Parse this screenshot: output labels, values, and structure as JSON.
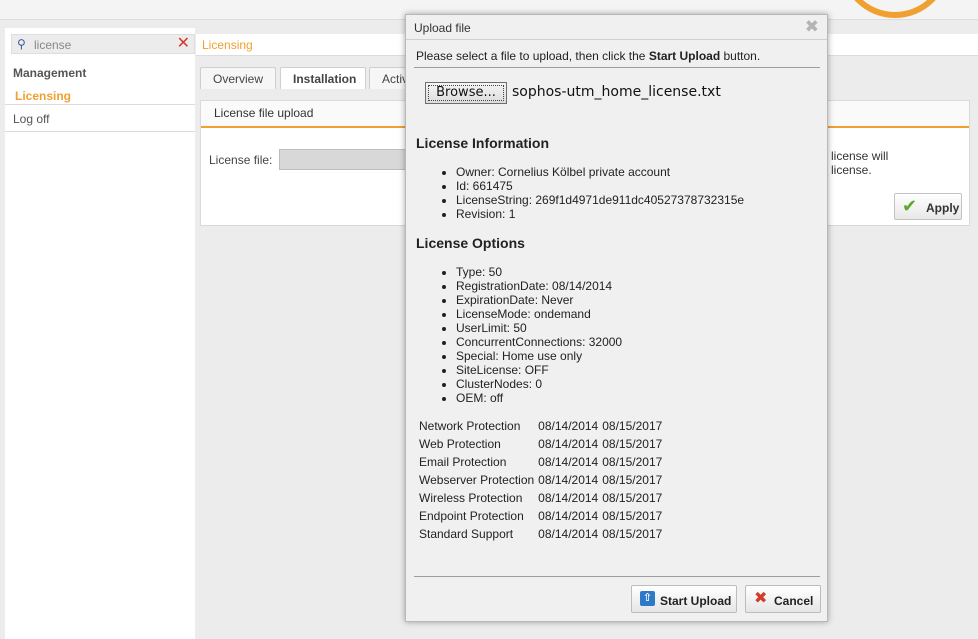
{
  "search": {
    "value": "license"
  },
  "nav": {
    "category": "Management",
    "selected": "Licensing",
    "logoff": "Log off"
  },
  "breadcrumb": "Licensing",
  "tabs": [
    "Overview",
    "Installation",
    "Activ"
  ],
  "panel": {
    "title": "License file upload",
    "field_label": "License file:",
    "side_note_line1": "license will",
    "side_note_line2": "license.",
    "apply_label": "Apply"
  },
  "dialog": {
    "title": "Upload file",
    "instruction_prefix": "Please select a file to upload, then click the ",
    "instruction_bold": "Start Upload",
    "instruction_suffix": " button.",
    "browse_label": "Browse...",
    "filename": "sophos-utm_home_license.txt",
    "license_info_title": "License Information",
    "license_info": [
      "Owner: Cornelius Kölbel private account",
      "Id: 661475",
      "LicenseString: 269f1d4971de911dc40527378732315e",
      "Revision: 1"
    ],
    "license_options_title": "License Options",
    "license_options": [
      "Type: 50",
      "RegistrationDate: 08/14/2014",
      "ExpirationDate: Never",
      "LicenseMode: ondemand",
      "UserLimit: 50",
      "ConcurrentConnections: 32000",
      "Special: Home use only",
      "SiteLicense: OFF",
      "ClusterNodes: 0",
      "OEM: off"
    ],
    "products": [
      {
        "name": "Network Protection",
        "start": "08/14/2014",
        "end": "08/15/2017"
      },
      {
        "name": "Web Protection",
        "start": "08/14/2014",
        "end": "08/15/2017"
      },
      {
        "name": "Email Protection",
        "start": "08/14/2014",
        "end": "08/15/2017"
      },
      {
        "name": "Webserver Protection",
        "start": "08/14/2014",
        "end": "08/15/2017"
      },
      {
        "name": "Wireless Protection",
        "start": "08/14/2014",
        "end": "08/15/2017"
      },
      {
        "name": "Endpoint Protection",
        "start": "08/14/2014",
        "end": "08/15/2017"
      },
      {
        "name": "Standard Support",
        "start": "08/14/2014",
        "end": "08/15/2017"
      }
    ],
    "start_upload_label": "Start Upload",
    "cancel_label": "Cancel"
  },
  "colors": {
    "accent": "#f0a030",
    "ok": "#5aab2c",
    "danger": "#d23c2c",
    "upload": "#2f79c9"
  }
}
